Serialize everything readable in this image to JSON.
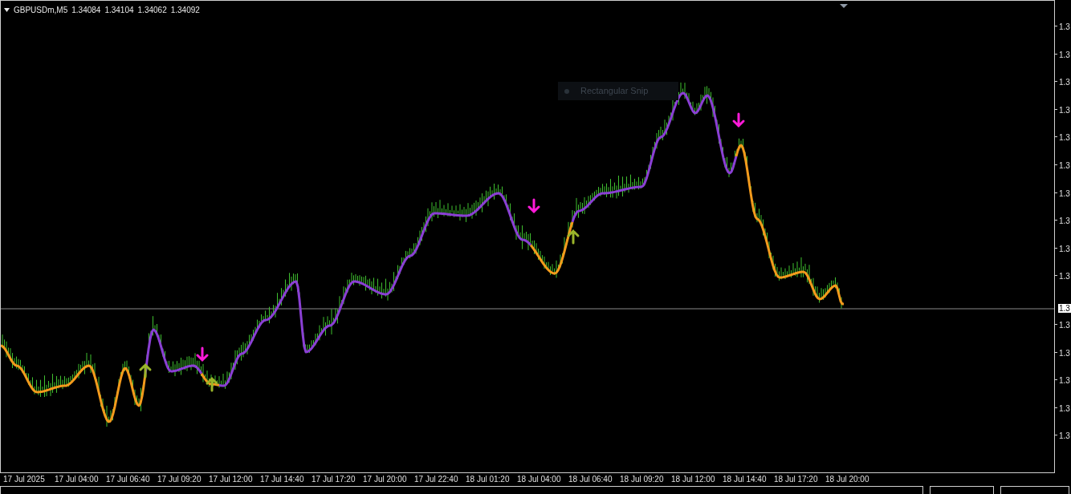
{
  "chart": {
    "header": {
      "symbol": "GBPUSDm,M5",
      "prices": [
        "1.34084",
        "1.34104",
        "1.34062",
        "1.34092"
      ]
    },
    "snip_tooltip": {
      "label": "Rectangular Snip"
    },
    "price_axis": {
      "labels_above": [
        "1.3",
        "1.3",
        "1.3",
        "1.3",
        "1.3",
        "1.3",
        "1.3",
        "1.3",
        "1.3",
        "1.3"
      ],
      "current_price": "1.3",
      "labels_below": [
        "1.3",
        "1.3",
        "1.3",
        "1.3",
        "1.3"
      ]
    },
    "time_axis": {
      "labels": [
        "17 Jul 2025",
        "17 Jul 04:00",
        "17 Jul 06:40",
        "17 Jul 09:20",
        "17 Jul 12:00",
        "17 Jul 14:40",
        "17 Jul 17:20",
        "17 Jul 20:00",
        "17 Jul 22:40",
        "18 Jul 01:20",
        "18 Jul 04:00",
        "18 Jul 06:40",
        "18 Jul 09:20",
        "18 Jul 12:00",
        "18 Jul 14:40",
        "18 Jul 17:20",
        "18 Jul 20:00"
      ]
    }
  }
}
